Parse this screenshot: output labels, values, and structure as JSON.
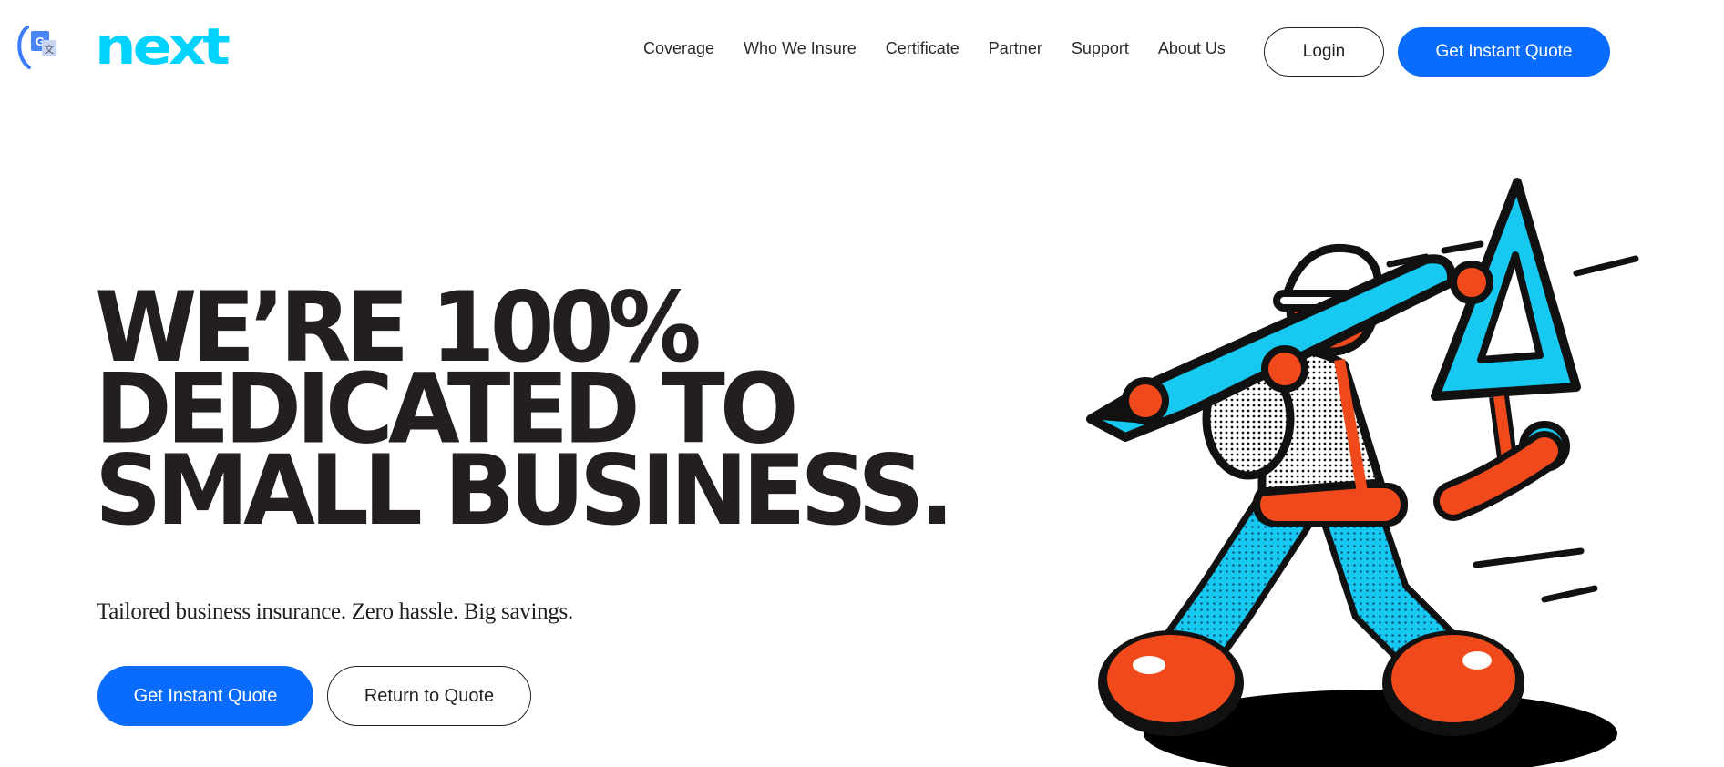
{
  "brand": {
    "logo_text": "next",
    "accent_color": "#00d3ff",
    "primary_button_color": "#0a6cff"
  },
  "header": {
    "translate_icon": "google-translate-icon",
    "nav": [
      {
        "label": "Coverage"
      },
      {
        "label": "Who We Insure"
      },
      {
        "label": "Certificate"
      },
      {
        "label": "Partner"
      },
      {
        "label": "Support"
      },
      {
        "label": "About Us"
      }
    ],
    "login_label": "Login",
    "quote_label": "Get Instant Quote"
  },
  "hero": {
    "headline": [
      "WE’RE 100%",
      "DEDICATED TO",
      "SMALL BUSINESS."
    ],
    "subhead": "Tailored business insurance. Zero hassle. Big savings.",
    "primary_cta": "Get Instant Quote",
    "secondary_cta": "Return to Quote",
    "illustration": "construction-worker-carrying-pencil-and-triangle-ruler"
  }
}
